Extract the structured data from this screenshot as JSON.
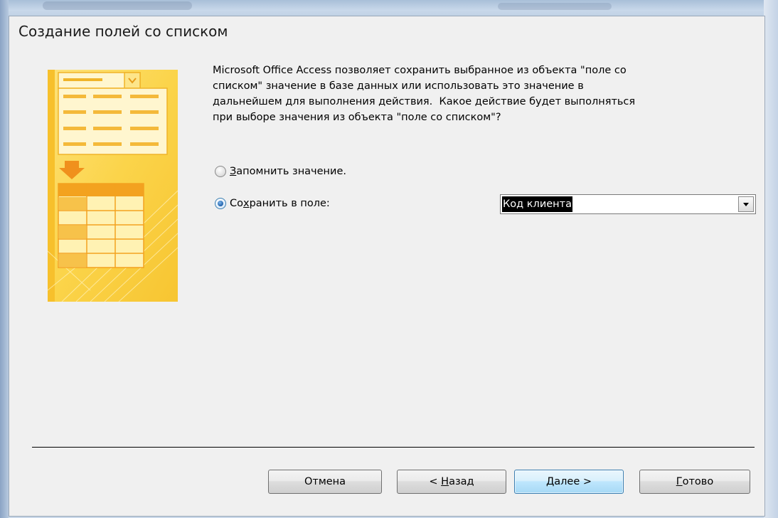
{
  "dialog": {
    "title": "Создание полей со списком",
    "description": "Microsoft Office Access позволяет сохранить выбранное из объекта \"поле со\nсписком\" значение в базе данных или использовать это значение в\nдальнейшем для выполнения действия.  Какое действие будет выполняться\nпри выборе значения из объекта \"поле со списком\"?"
  },
  "options": {
    "remember_label_accel": "З",
    "remember_label_rest": "апомнить значение.",
    "save_label_pre": "Со",
    "save_label_accel": "х",
    "save_label_rest": "ранить в поле:",
    "selected": "save"
  },
  "field_combo": {
    "value": "Код клиента"
  },
  "buttons": {
    "cancel": "Отмена",
    "back_pre": "< ",
    "back_accel": "Н",
    "back_rest": "азад",
    "next_accel": "Д",
    "next_rest": "алее >",
    "finish_accel": "Г",
    "finish_rest": "отово"
  },
  "colors": {
    "dialog_bg": "#f0f0f0",
    "illustration_yellow": "#fbd44a",
    "illustration_orange": "#f3a21f",
    "radio_selected": "#1e5fa8",
    "default_button": "#bee6fd"
  }
}
